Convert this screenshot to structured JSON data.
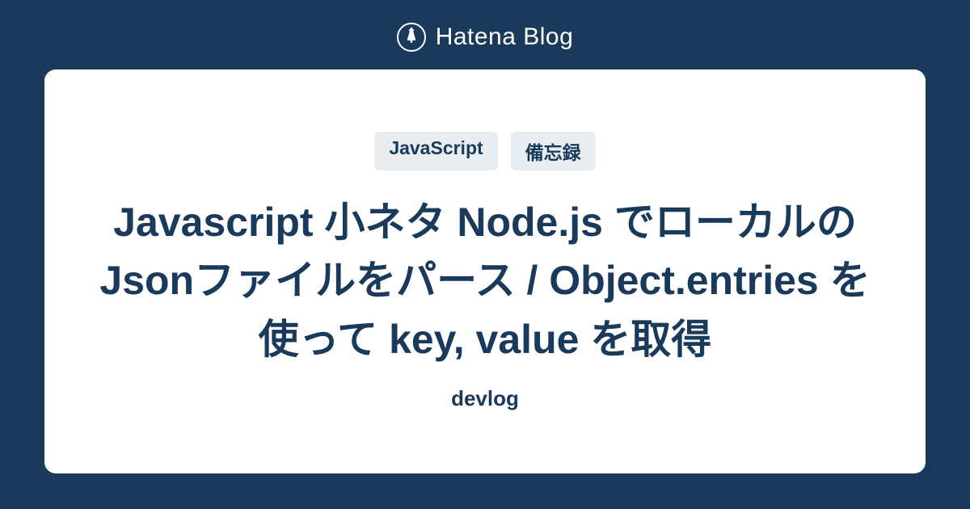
{
  "header": {
    "logo_text": "Hatena Blog"
  },
  "card": {
    "tags": [
      "JavaScript",
      "備忘録"
    ],
    "title": "Javascript 小ネタ Node.js でローカルのJsonファイルをパース / Object.entries を使って key, value を取得",
    "subtitle": "devlog"
  }
}
